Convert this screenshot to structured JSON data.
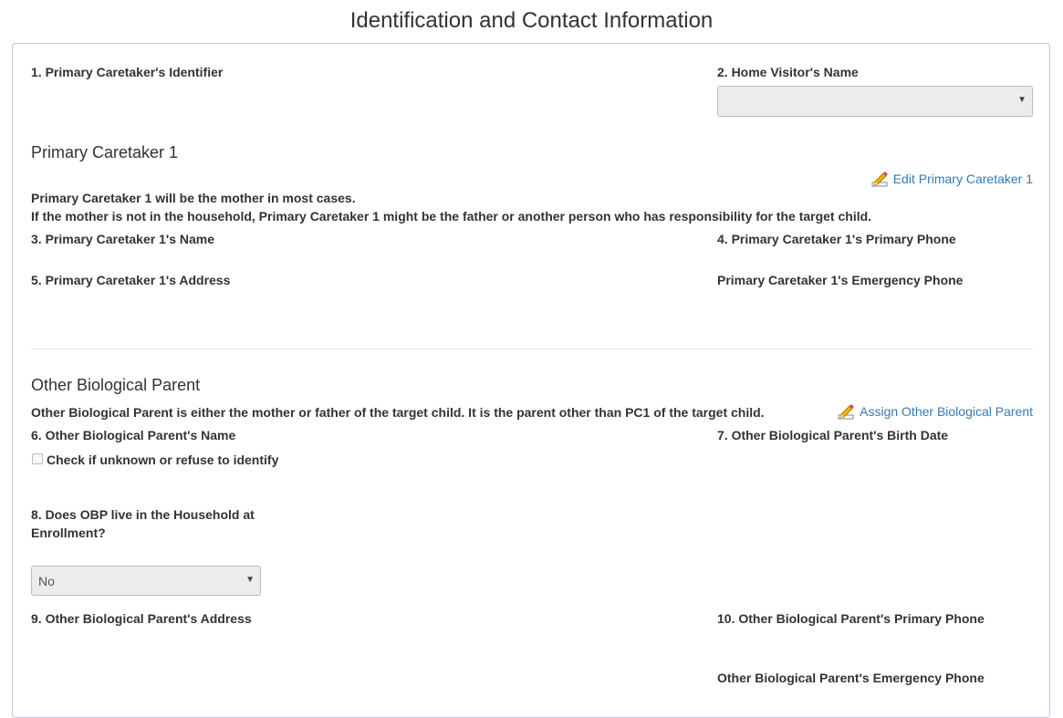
{
  "page": {
    "title": "Identification and Contact Information"
  },
  "fields": {
    "q1": "1. Primary Caretaker's Identifier",
    "q2": "2. Home Visitor's Name",
    "q2_value": ""
  },
  "pc1": {
    "heading": "Primary Caretaker 1",
    "edit_link": "Edit Primary Caretaker 1",
    "note1": "Primary Caretaker 1 will be the mother in most cases.",
    "note2": "If the mother is not in the household, Primary Caretaker 1 might be the father or another person who has responsibility for the target child.",
    "q3": "3. Primary Caretaker 1's Name",
    "q4": "4. Primary Caretaker 1's Primary Phone",
    "q5": "5. Primary Caretaker 1's Address",
    "emergency": "Primary Caretaker 1's Emergency Phone"
  },
  "obp": {
    "heading": "Other Biological Parent",
    "assign_link": "Assign Other Biological Parent",
    "note": "Other Biological Parent is either the mother or father of the target child. It is the parent other than PC1 of the target child.",
    "q6": "6. Other Biological Parent's Name",
    "checkbox_label": "Check if unknown or refuse to identify",
    "q7": "7. Other Biological Parent's Birth Date",
    "q8_line1": "8. Does OBP live in the Household at",
    "q8_line2": "Enrollment?",
    "q8_value": "No",
    "q9": "9. Other Biological Parent's Address",
    "q10": "10. Other Biological Parent's Primary Phone",
    "emergency": "Other Biological Parent's Emergency Phone"
  },
  "icons": {
    "pencil": "pencil-edit-icon",
    "dropdown": "triangle-down-icon"
  }
}
